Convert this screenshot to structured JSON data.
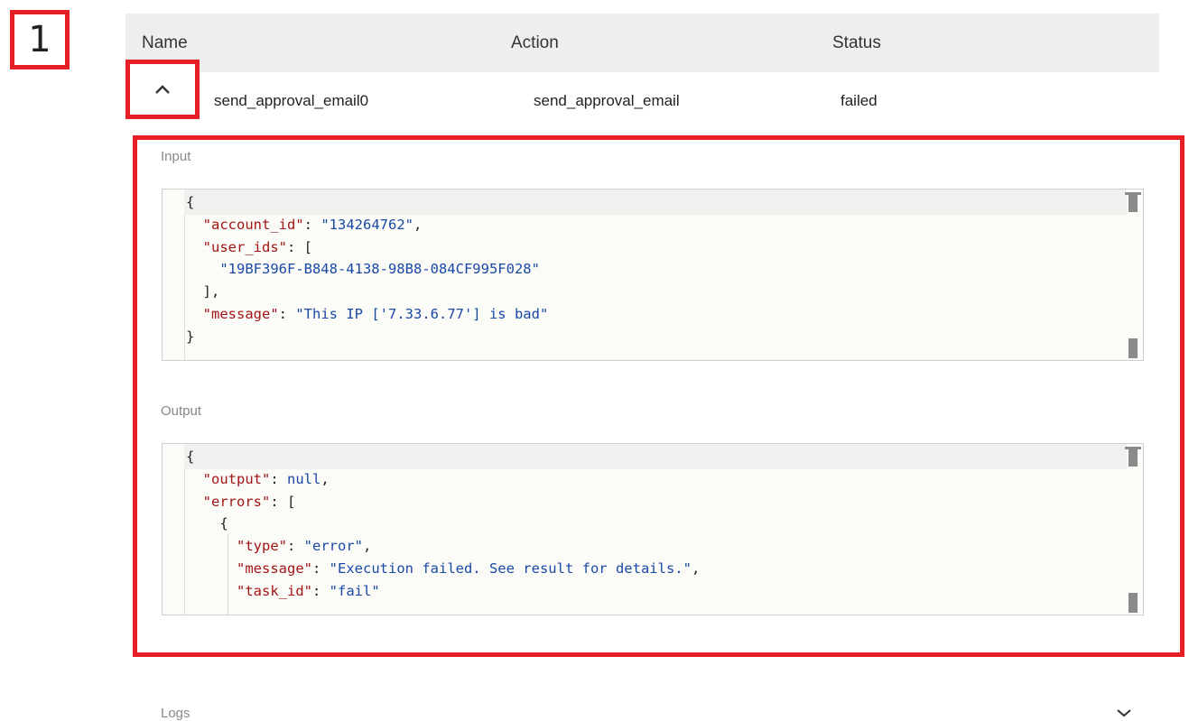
{
  "step_badge": "1",
  "table": {
    "headers": {
      "name": "Name",
      "action": "Action",
      "status": "Status"
    },
    "row": {
      "name": "send_approval_email0",
      "action": "send_approval_email",
      "status": "failed"
    }
  },
  "details": {
    "input_label": "Input",
    "output_label": "Output",
    "input_code": [
      "{",
      "  \"account_id\": \"134264762\",",
      "  \"user_ids\": [",
      "    \"19BF396F-B848-4138-98B8-084CF995F028\"",
      "  ],",
      "  \"message\": \"This IP ['7.33.6.77'] is bad\"",
      "}"
    ],
    "output_code": [
      "{",
      "  \"output\": null,",
      "  \"errors\": [",
      "    {",
      "      \"type\": \"error\",",
      "      \"message\": \"Execution failed. See result for details.\",",
      "      \"task_id\": \"fail\""
    ]
  },
  "logs_label": "Logs",
  "icons": {
    "expand_toggle": "chevron-up-icon",
    "logs_toggle": "chevron-down-icon"
  },
  "colors": {
    "highlight": "#e61e26",
    "json_key": "#a31515",
    "json_value": "#1a49a5"
  }
}
